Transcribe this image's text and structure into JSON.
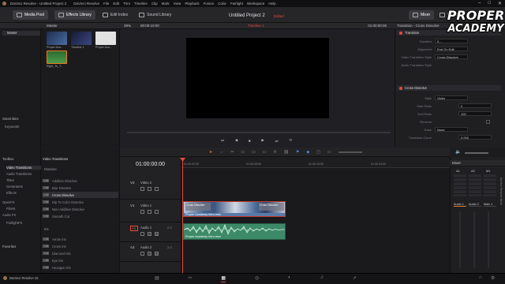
{
  "titlebar": {
    "app_title": "DaVinci Resolve - Untitled Project 2",
    "menus": [
      "DaVinci Resolve",
      "File",
      "Edit",
      "Trim",
      "Timeline",
      "Clip",
      "Mark",
      "View",
      "Playback",
      "Fusion",
      "Color",
      "Fairlight",
      "Workspace",
      "Help"
    ]
  },
  "toolbar": {
    "media_pool": "Media Pool",
    "effects_library": "Effects Library",
    "edit_index": "Edit Index",
    "sound_library": "Sound Library",
    "project_title": "Untitled Project 2",
    "edited": "Edited",
    "mixer": "Mixer",
    "metadata": "Metad"
  },
  "media_pool": {
    "bin_header": "Master",
    "bins": [
      "Master"
    ],
    "smart_bins": "Smart Bins",
    "keywords": "Keywords",
    "clips": [
      {
        "label": "Proper Aca...",
        "color": "#2a3a5c"
      },
      {
        "label": "Timeline 1",
        "color": "#1f2340"
      },
      {
        "label": "Proper Aca...",
        "color": "#dcdcdc"
      },
      {
        "label": "Right_To_T...",
        "color": "#3e7f3e"
      }
    ]
  },
  "viewer": {
    "zoom": "29%",
    "timecode_left": "00:00:10:00",
    "timeline_name": "Timeline 1",
    "timecode_right": "01:00:00:00"
  },
  "inspector": {
    "header": "Transition - Cross Dissolve",
    "tab_transition": "Transition",
    "fields": [
      {
        "label": "Duration",
        "value": "5..."
      },
      {
        "label": "Alignment",
        "value": "End On Edit"
      },
      {
        "label": "Video Transition Style",
        "value": "Cross Dissolve"
      },
      {
        "label": "Audio Transition Style",
        "value": ""
      }
    ],
    "section": "Cross Dissolve",
    "section_fields": [
      {
        "label": "Style",
        "value": "Video"
      },
      {
        "label": "Start Ratio",
        "value": "0"
      },
      {
        "label": "End Ratio",
        "value": "100"
      },
      {
        "label": "Reverse",
        "value": ""
      },
      {
        "label": "Ease",
        "value": "None"
      },
      {
        "label": "Transition Curve",
        "value": "0.000"
      }
    ]
  },
  "effects_panel": {
    "toolbox": "Toolbox",
    "tree": [
      "Video Transitions",
      "Audio Transitions",
      "Titles",
      "Generators",
      "Effects",
      "OpenFX",
      "Filters",
      "Audio FX",
      "FairlightFX"
    ],
    "favorites": "Favorites",
    "list_header": "Video Transitions",
    "group_dissolve": "Dissolve",
    "dissolve_items": [
      "Additive Dissolve",
      "Blur Dissolve",
      "Cross Dissolve",
      "Dip To Color Dissolve",
      "Non-Additive Dissolve",
      "Smooth Cut"
    ],
    "group_iris": "Iris",
    "iris_items": [
      "Arrow Iris",
      "Cross Iris",
      "Diamond Iris",
      "Eye Iris",
      "Hexagon Iris"
    ]
  },
  "timeline": {
    "timecode": "01:00:00:00",
    "ruler": [
      "01:00:00:00",
      "01:00:08:00",
      "01:00:16:00",
      "01:00:24:00"
    ],
    "tracks": [
      {
        "id": "V2",
        "name": "Video 2",
        "info": ""
      },
      {
        "id": "V1",
        "name": "Video 1",
        "info": ""
      },
      {
        "id": "A1",
        "name": "Audio 1",
        "info": "2.0"
      },
      {
        "id": "A2",
        "name": "Audio 2",
        "info": "2.0"
      }
    ],
    "clips": {
      "video_a": "Cross Dissolve",
      "video_b": "Cross Dissolve",
      "video_name": "Proper Academy Intro.mov",
      "audio_name": "Proper Academy Intro.mov"
    }
  },
  "mixer": {
    "header": "Mixer",
    "channels": [
      "A1",
      "A2",
      "M1"
    ],
    "buses": [
      "Audio 1",
      "Audio 2",
      "Main 1"
    ],
    "side_label": "DaVinci Resolve Mixer"
  },
  "status": {
    "app": "DaVinci Resolve 15"
  },
  "logo": {
    "line1": "PROPER",
    "line2": "ACADEMY"
  },
  "colors": {
    "accent_red": "#e64a3d",
    "clip_blue": "#4a6c9a",
    "audio_green": "#4d9a75"
  }
}
